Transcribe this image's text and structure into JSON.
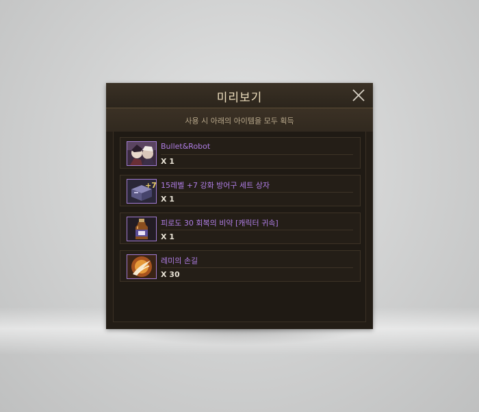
{
  "dialog": {
    "title": "미리보기",
    "subtitle": "사용 시 아래의 아이템을 모두 획득"
  },
  "items": [
    {
      "name": "Bullet&Robot",
      "quantity": "X 1",
      "icon": "bullet-robot-avatar-icon"
    },
    {
      "name": "15레벨 +7 강화 방어구 세트 상자",
      "quantity": "X 1",
      "icon": "armor-box-icon",
      "enhance_label": "+7"
    },
    {
      "name": "피로도 30 회복의 비약 [캐릭터 귀속]",
      "quantity": "X 1",
      "icon": "potion-bottle-icon"
    },
    {
      "name": "레미의 손길",
      "quantity": "X 30",
      "icon": "remy-touch-icon"
    }
  ],
  "colors": {
    "item_name": "#b07ee6",
    "icon_border": "#a37dd6",
    "title": "#efe0bf",
    "dialog_bg": "#231d16"
  }
}
